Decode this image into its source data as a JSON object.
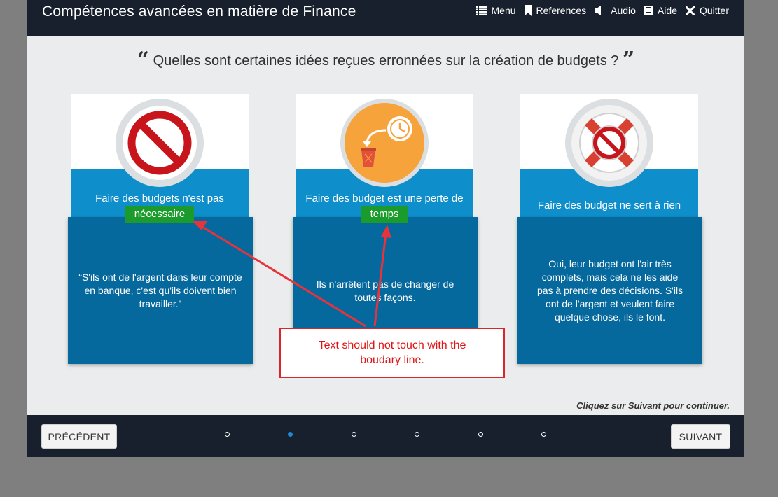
{
  "header": {
    "title": "Compétences avancées en matière de Finance",
    "nav": [
      {
        "label": "Menu",
        "icon": "list-icon"
      },
      {
        "label": "References",
        "icon": "bookmark-icon"
      },
      {
        "label": "Audio",
        "icon": "speaker-icon"
      },
      {
        "label": "Aide",
        "icon": "book-icon"
      },
      {
        "label": "Quitter",
        "icon": "close-icon"
      }
    ]
  },
  "question": {
    "open_quote": "“",
    "text": "Quelles sont certaines idées reçues erronnées sur la création de budgets ?",
    "close_quote": "”"
  },
  "cards": [
    {
      "icon": "prohibition-icon",
      "title_line1": "Faire des budgets n'est pas",
      "title_highlight": "nécessaire",
      "text": "“S'ils ont de l'argent dans leur compte en banque, c'est qu'ils doivent bien travailler.”"
    },
    {
      "icon": "clock-trash-icon",
      "title_line1": "Faire des budget est une perte de",
      "title_highlight": "temps",
      "text": "Ils n'arrêtent pas de changer de toutes façons."
    },
    {
      "icon": "lifebuoy-prohibition-icon",
      "title_line1": "Faire des budget ne sert à rien",
      "text": "Oui, leur budget ont l'air très complets, mais cela ne les aide pas à prendre des décisions. S'ils ont de l'argent et veulent faire quelque chose, ils le font."
    }
  ],
  "annotation": {
    "text": "Text should not touch with the boudary line.",
    "color": "#e01414"
  },
  "footer": {
    "continue_hint": "Cliquez sur Suivant pour continuer.",
    "prev_label": "PRÉCÉDENT",
    "next_label": "SUIVANT",
    "pages": 6,
    "current_page": 2
  },
  "colors": {
    "bar_bg": "#18202d",
    "card_head": "#0e8fcb",
    "card_body": "#06699d",
    "highlight": "#1a9b2b",
    "active_dot": "#1e88d6"
  }
}
